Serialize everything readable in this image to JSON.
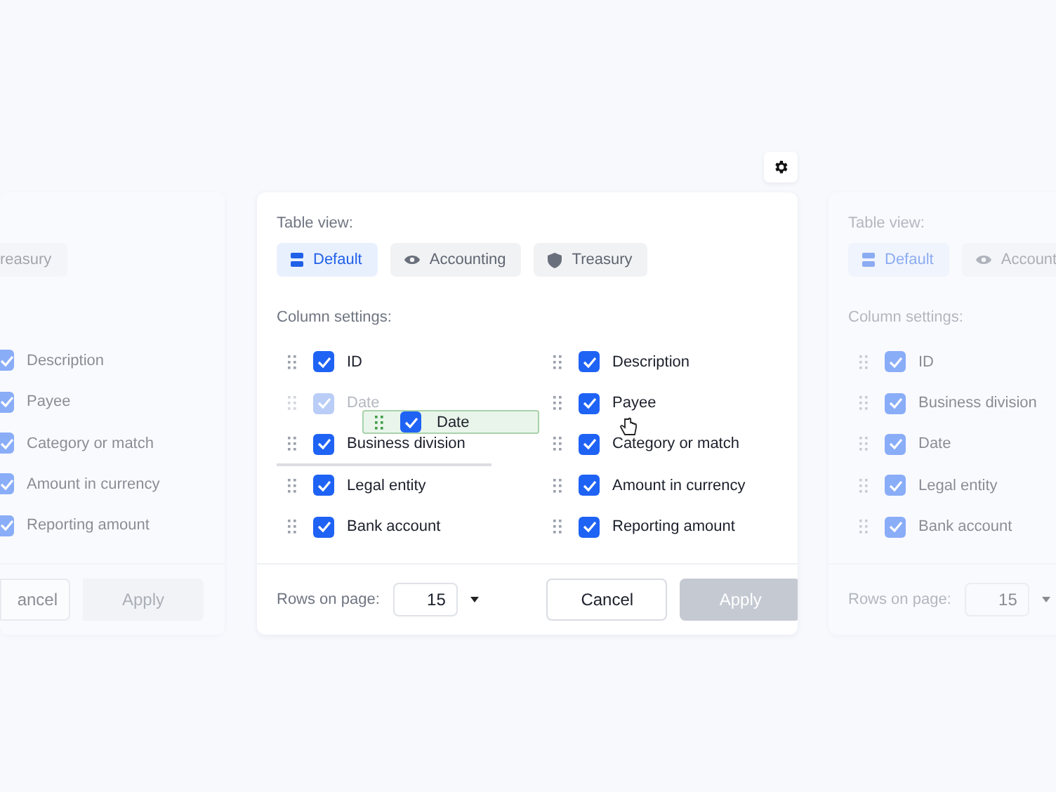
{
  "left": {
    "views": [
      {
        "label": "reasury",
        "selected": false
      }
    ],
    "columns": [
      {
        "label": "Description",
        "checked": true
      },
      {
        "label": "Payee",
        "checked": true
      },
      {
        "label": "Category or match",
        "checked": true
      },
      {
        "label": "Amount in currency",
        "checked": true
      },
      {
        "label": "Reporting amount",
        "checked": true
      }
    ],
    "buttons": [
      {
        "label": "ancel",
        "kind": "secondary",
        "disabled": false
      },
      {
        "label": "Apply",
        "kind": "primary",
        "disabled": true
      }
    ]
  },
  "main": {
    "title": "Table view:",
    "views": [
      {
        "label": "Default",
        "selected": true
      },
      {
        "label": "Accounting",
        "selected": false
      },
      {
        "label": "Treasury",
        "selected": false
      }
    ],
    "columns_title": "Column settings:",
    "columns": [
      [
        {
          "label": "ID",
          "checked": true,
          "ghost": false,
          "drop_below": false
        },
        {
          "label": "Date",
          "checked": true,
          "ghost": true,
          "drop_below": false
        },
        {
          "label": "Business division",
          "checked": true,
          "ghost": false,
          "drop_below": true
        },
        {
          "label": "Legal entity",
          "checked": true,
          "ghost": false,
          "drop_below": false
        },
        {
          "label": "Bank account",
          "checked": true,
          "ghost": false,
          "drop_below": false
        }
      ],
      [
        {
          "label": "Description",
          "checked": true,
          "ghost": false,
          "drop_below": false
        },
        {
          "label": "Payee",
          "checked": true,
          "ghost": false,
          "drop_below": false
        },
        {
          "label": "Category or match",
          "checked": true,
          "ghost": false,
          "drop_below": false
        },
        {
          "label": "Amount in currency",
          "checked": true,
          "ghost": false,
          "drop_below": false
        },
        {
          "label": "Reporting amount",
          "checked": true,
          "ghost": false,
          "drop_below": false
        }
      ]
    ],
    "dragged": {
      "label": "Date",
      "checked": true
    },
    "rows_label": "Rows on page:",
    "rows_value": "15",
    "buttons": [
      {
        "label": "Cancel",
        "kind": "secondary",
        "disabled": false
      },
      {
        "label": "Apply",
        "kind": "primary",
        "disabled": true
      }
    ]
  },
  "right": {
    "title": "Table view:",
    "views": [
      {
        "label": "Default",
        "selected": true
      },
      {
        "label": "Account",
        "selected": false
      }
    ],
    "columns_title": "Column settings:",
    "columns": [
      {
        "label": "ID",
        "checked": true
      },
      {
        "label": "Business division",
        "checked": true
      },
      {
        "label": "Date",
        "checked": true
      },
      {
        "label": "Legal entity",
        "checked": true
      },
      {
        "label": "Bank account",
        "checked": true
      }
    ],
    "rows_label": "Rows on page:",
    "rows_value": "15"
  }
}
